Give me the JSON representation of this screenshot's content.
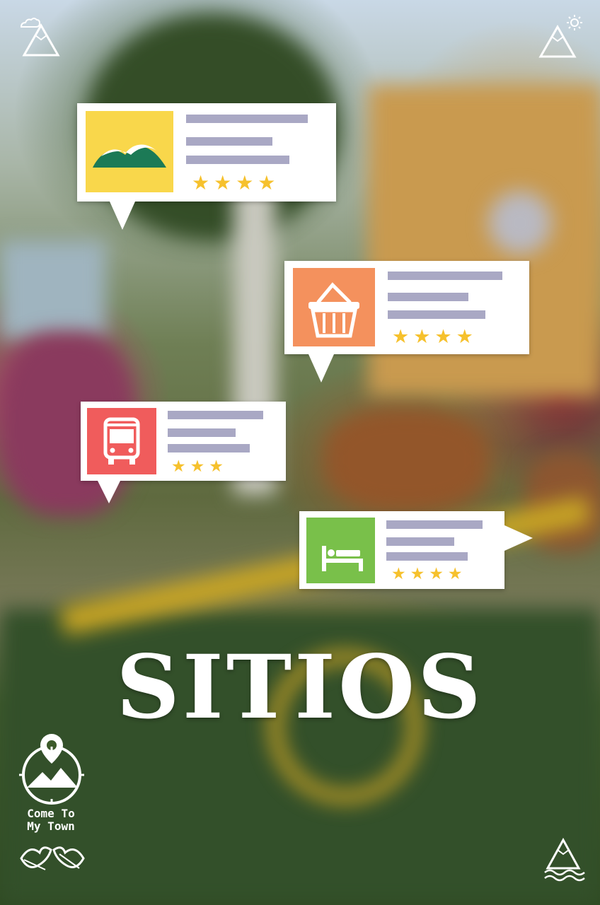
{
  "hero": {
    "title": "SITIOS"
  },
  "brand": {
    "line1": "Come To",
    "line2": "My Town"
  },
  "cards": [
    {
      "category": "nature",
      "icon": "mountain-icon",
      "tile_color": "#f9d74b",
      "rating": 4
    },
    {
      "category": "shopping",
      "icon": "basket-icon",
      "tile_color": "#f4915d",
      "rating": 4
    },
    {
      "category": "transport",
      "icon": "bus-icon",
      "tile_color": "#f05c5c",
      "rating": 3
    },
    {
      "category": "lodging",
      "icon": "bed-icon",
      "tile_color": "#79c04a",
      "rating": 4
    }
  ],
  "colors": {
    "line": "#a9a8c4",
    "star": "#f6c12d",
    "card": "#ffffff"
  }
}
